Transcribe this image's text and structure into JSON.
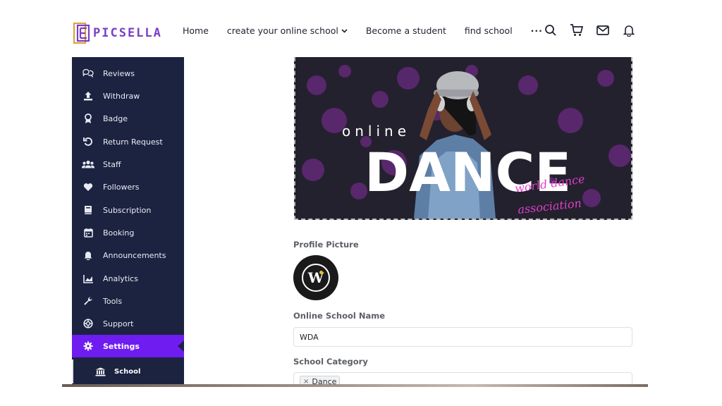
{
  "brand": {
    "name": "PICSELLA",
    "logo_letter": "E",
    "accent": "#7a3fc6"
  },
  "nav": {
    "items": [
      "Home",
      "create your online school",
      "Become a student",
      "find school"
    ],
    "more": "···"
  },
  "header_icons": [
    "search-icon",
    "cart-icon",
    "mail-icon",
    "bell-icon"
  ],
  "sidebar": {
    "items": [
      {
        "label": "Reviews",
        "icon": "reviews-icon"
      },
      {
        "label": "Withdraw",
        "icon": "upload-icon"
      },
      {
        "label": "Badge",
        "icon": "badge-icon"
      },
      {
        "label": "Return Request",
        "icon": "undo-icon"
      },
      {
        "label": "Staff",
        "icon": "users-icon"
      },
      {
        "label": "Followers",
        "icon": "heart-icon"
      },
      {
        "label": "Subscription",
        "icon": "book-icon"
      },
      {
        "label": "Booking",
        "icon": "calendar-icon"
      },
      {
        "label": "Announcements",
        "icon": "bell-icon"
      },
      {
        "label": "Analytics",
        "icon": "chart-icon"
      },
      {
        "label": "Tools",
        "icon": "wrench-icon"
      },
      {
        "label": "Support",
        "icon": "lifebuoy-icon"
      },
      {
        "label": "Settings",
        "icon": "gear-icon",
        "active": true
      }
    ],
    "sub_item": {
      "label": "School",
      "icon": "bank-icon"
    },
    "bg_color": "#1c2340",
    "active_color": "#6f1cf0"
  },
  "banner": {
    "word_small": "online",
    "word_big": "DANCE",
    "script_line1": "world dance",
    "script_line2": "association"
  },
  "form": {
    "profile_picture_label": "Profile Picture",
    "avatar_letter": "W",
    "school_name_label": "Online School Name",
    "school_name_value": "WDA",
    "category_label": "School Category",
    "category_tag": "Dance",
    "tag_remove": "×"
  }
}
